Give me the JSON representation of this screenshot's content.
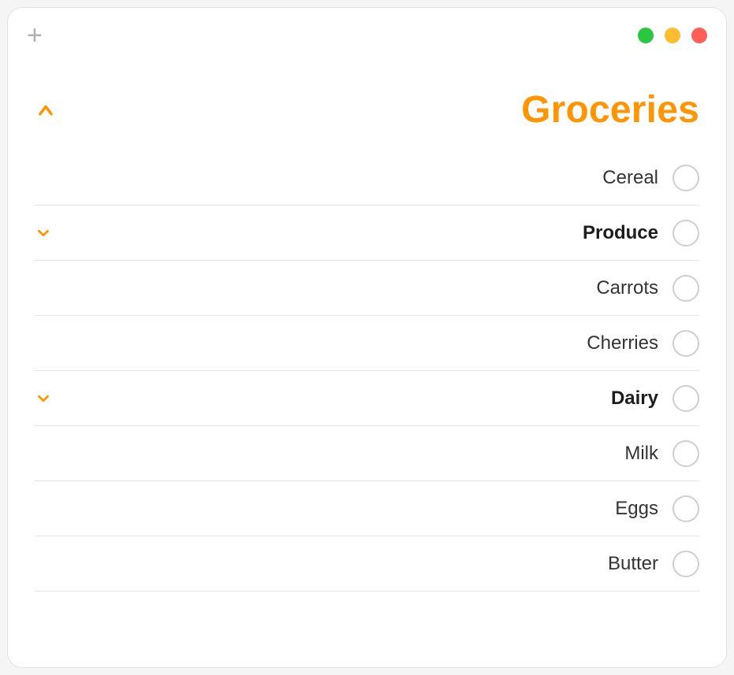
{
  "colors": {
    "accent": "#ff9500"
  },
  "toolbar": {
    "add_label": "+"
  },
  "list": {
    "title": "Groceries",
    "items": [
      {
        "label": "Cereal",
        "bold": false,
        "has_chevron": false,
        "indent": false
      },
      {
        "label": "Produce",
        "bold": true,
        "has_chevron": true,
        "indent": false
      },
      {
        "label": "Carrots",
        "bold": false,
        "has_chevron": false,
        "indent": true
      },
      {
        "label": "Cherries",
        "bold": false,
        "has_chevron": false,
        "indent": true
      },
      {
        "label": "Dairy",
        "bold": true,
        "has_chevron": true,
        "indent": false
      },
      {
        "label": "Milk",
        "bold": false,
        "has_chevron": false,
        "indent": true
      },
      {
        "label": "Eggs",
        "bold": false,
        "has_chevron": false,
        "indent": true
      },
      {
        "label": "Butter",
        "bold": false,
        "has_chevron": false,
        "indent": true
      }
    ]
  }
}
